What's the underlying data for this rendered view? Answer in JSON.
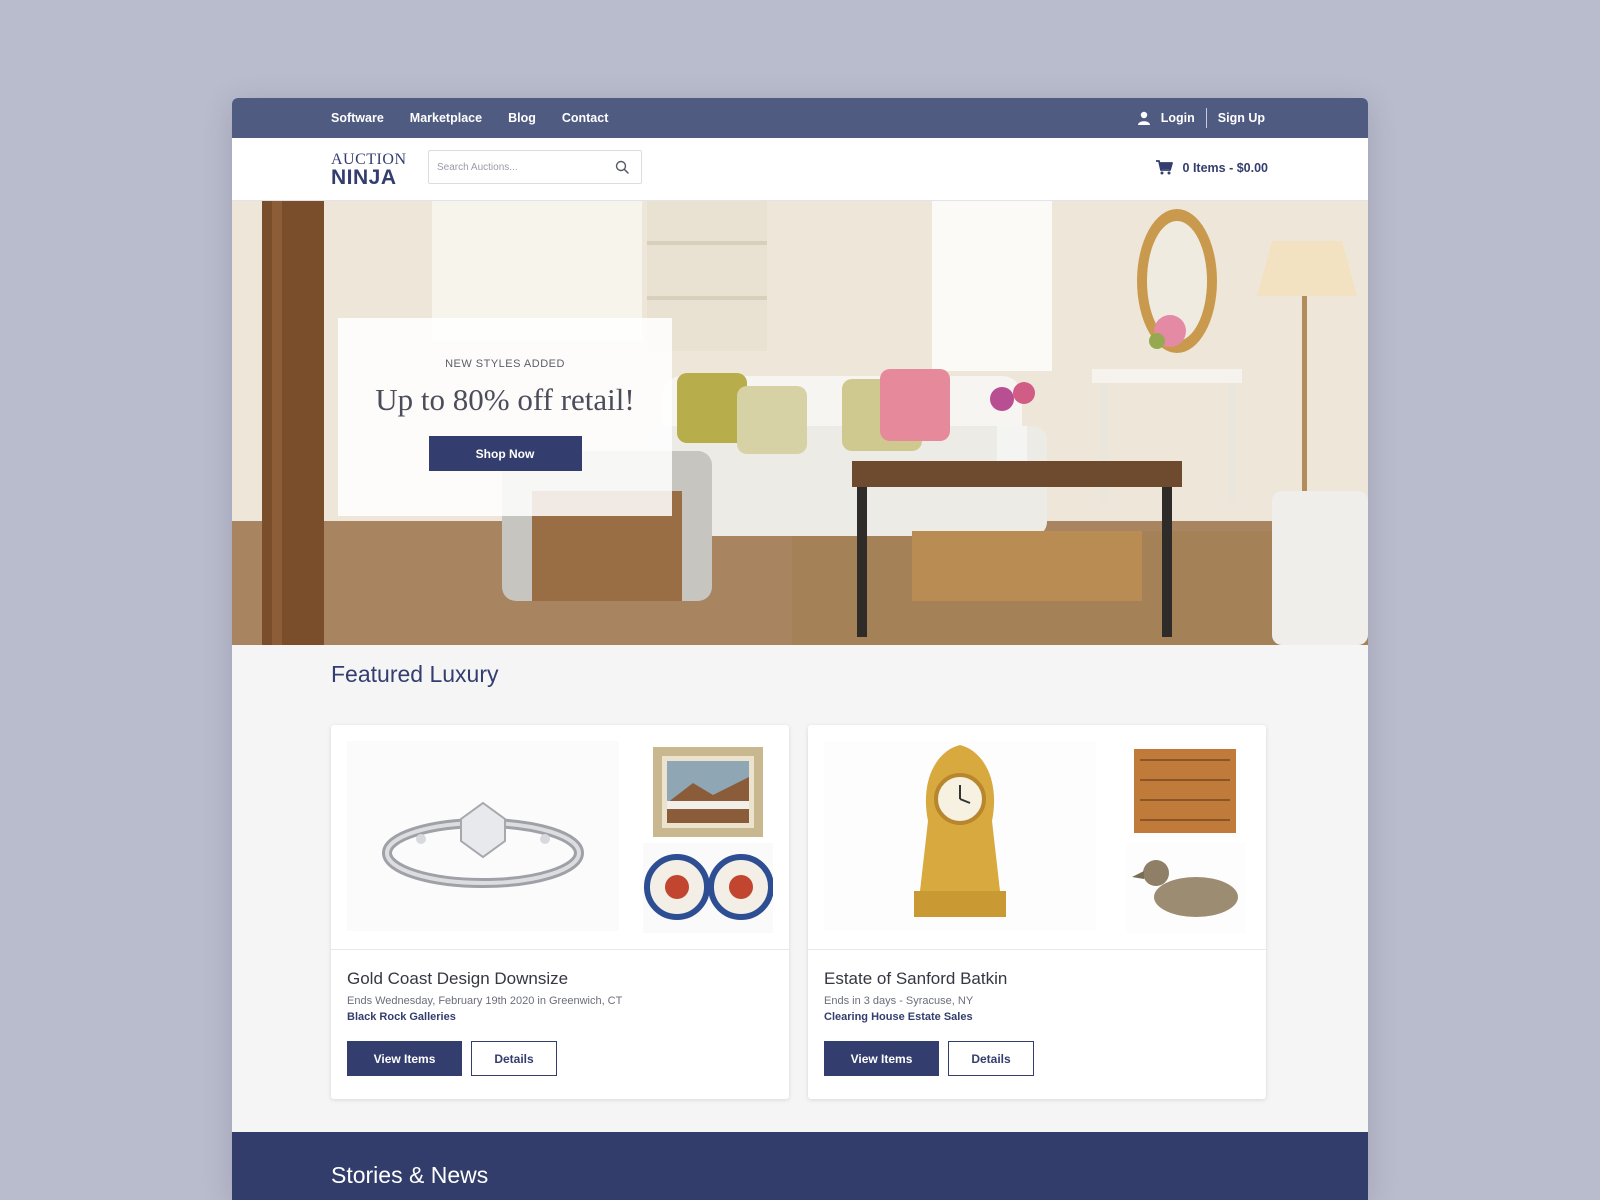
{
  "topnav": {
    "links": [
      "Software",
      "Marketplace",
      "Blog",
      "Contact"
    ],
    "login": "Login",
    "signup": "Sign Up"
  },
  "header": {
    "logo_line1": "AUCTION",
    "logo_line2": "NINJA",
    "search_placeholder": "Search Auctions...",
    "cart": "0 Items - $0.00"
  },
  "hero": {
    "kicker": "NEW STYLES ADDED",
    "headline": "Up to 80% off retail!",
    "cta": "Shop Now"
  },
  "featured": {
    "title": "Featured Luxury",
    "cards": [
      {
        "title": "Gold Coast Design Downsize",
        "meta": "Ends Wednesday, February 19th 2020 in Greenwich, CT",
        "seller": "Black Rock Galleries",
        "view": "View Items",
        "details": "Details"
      },
      {
        "title": "Estate of Sanford Batkin",
        "meta": "Ends in 3 days - Syracuse, NY",
        "seller": "Clearing House Estate Sales",
        "view": "View Items",
        "details": "Details"
      }
    ]
  },
  "stories": {
    "title": "Stories & News"
  },
  "colors": {
    "navy": "#343e6e",
    "topbar": "#505b82",
    "background": "#b9bccc"
  }
}
